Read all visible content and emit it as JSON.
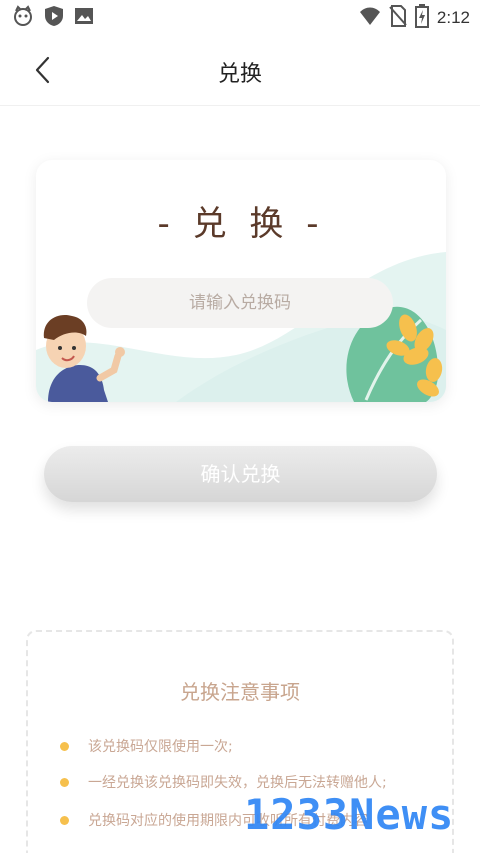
{
  "status_bar": {
    "time": "2:12"
  },
  "app_bar": {
    "title": "兑换"
  },
  "card": {
    "title": "- 兑 换 -",
    "input_placeholder": "请输入兑换码",
    "input_value": ""
  },
  "confirm_button": {
    "label": "确认兑换"
  },
  "notice": {
    "title": "兑换注意事项",
    "items": [
      "该兑换码仅限使用一次;",
      "一经兑换该兑换码即失效，兑换后无法转赠他人;",
      "兑换码对应的使用期限内可收听所有付费内容"
    ]
  },
  "watermark": {
    "text": "1233News"
  },
  "colors": {
    "accent_title": "#5b3a2a",
    "notice_text": "#c9a794",
    "bullet": "#f6c04d",
    "button_bg": "#dcdcdc"
  }
}
